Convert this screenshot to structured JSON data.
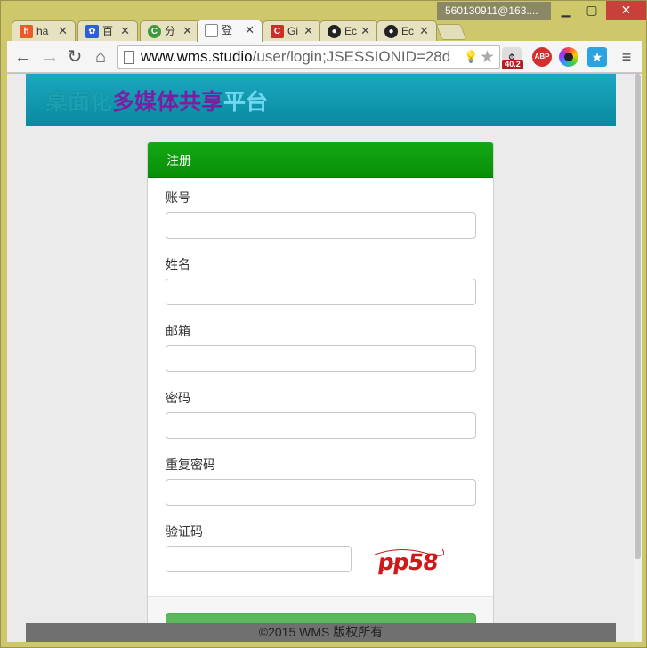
{
  "window": {
    "user": "560130911@163....",
    "minimize": "▁",
    "maximize": "▢",
    "close": "✕"
  },
  "tabs": [
    {
      "label": "ha",
      "icon": "hao-icon",
      "color": "#e85b2a"
    },
    {
      "label": "百",
      "icon": "baidu-icon",
      "color": "#2b60d8"
    },
    {
      "label": "分",
      "icon": "c-green-icon",
      "color": "#3c9a3c"
    },
    {
      "label": "登",
      "icon": "page-icon",
      "color": "#ffffff",
      "active": true
    },
    {
      "label": "Gi",
      "icon": "csdn-icon",
      "color": "#c8302a"
    },
    {
      "label": "Ec",
      "icon": "github-icon",
      "color": "#222222"
    },
    {
      "label": "Ec",
      "icon": "github-icon",
      "color": "#222222"
    }
  ],
  "toolbar": {
    "back": "←",
    "forward": "→",
    "reload": "↻",
    "home": "⌂",
    "url_host": "www.wms.studio",
    "url_path": "/user/login;JSESSIONID=28d",
    "speed_badge": "40.2",
    "abp": "ABP",
    "menu": "≡"
  },
  "site": {
    "brand_part1": "桌面化",
    "brand_part2": "多媒体共享",
    "brand_part3": "平台",
    "footer": "©2015 WMS 版权所有"
  },
  "form": {
    "title": "注册",
    "fields": [
      {
        "label": "账号",
        "value": ""
      },
      {
        "label": "姓名",
        "value": ""
      },
      {
        "label": "邮箱",
        "value": ""
      },
      {
        "label": "密码",
        "value": ""
      },
      {
        "label": "重复密码",
        "value": ""
      },
      {
        "label": "验证码",
        "value": ""
      }
    ],
    "captcha_text": "pp58"
  },
  "colors": {
    "header_green": "#0a950a",
    "site_header": "#0f9ab2",
    "brand_purple": "#7b1fa2",
    "submit_green": "#5cb85c"
  }
}
